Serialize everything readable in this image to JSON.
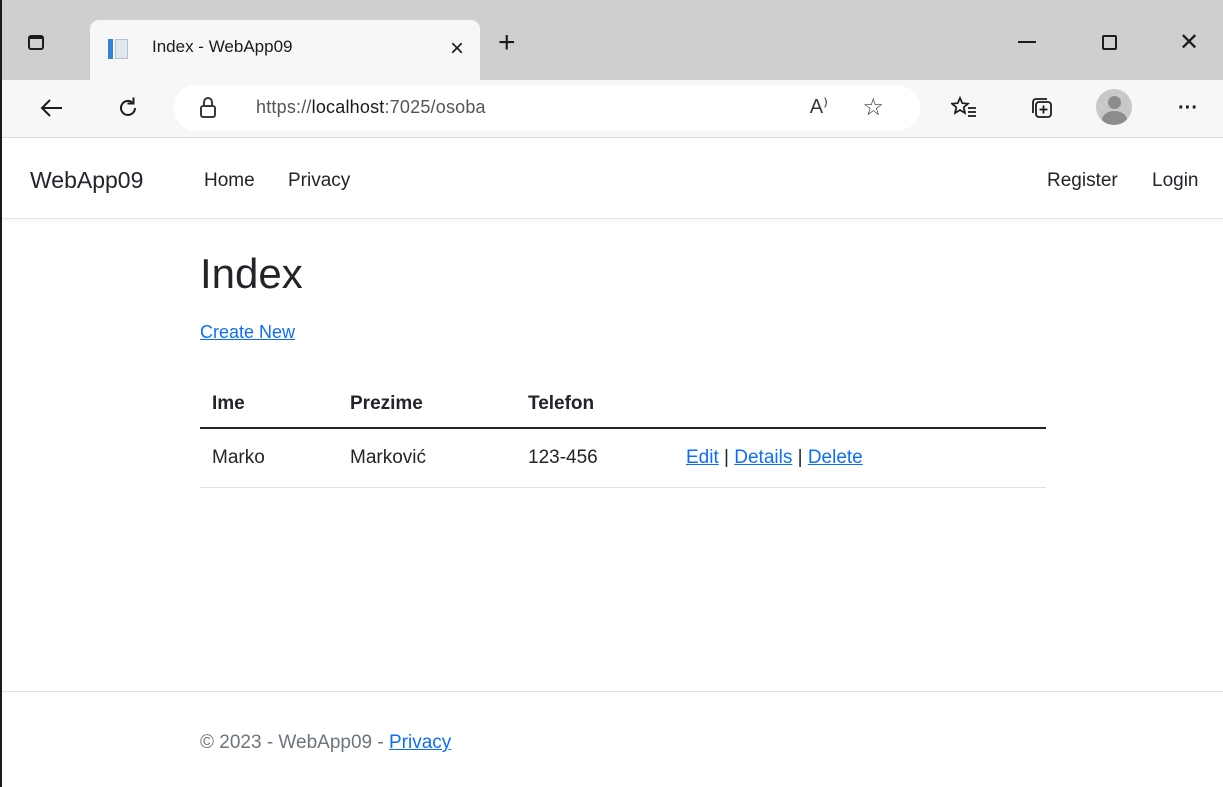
{
  "browser": {
    "tab_title": "Index - WebApp09",
    "tab_close": "×",
    "new_tab": "+",
    "url_prefix": "https://",
    "url_host": "localhost",
    "url_rest": ":7025/osoba",
    "read_aloud": "A⁾",
    "more": "···",
    "window_close": "✕"
  },
  "navbar": {
    "brand": "WebApp09",
    "links": [
      "Home",
      "Privacy"
    ],
    "right_links": [
      "Register",
      "Login"
    ]
  },
  "main": {
    "title": "Index",
    "create_link": "Create New",
    "table": {
      "headers": [
        "Ime",
        "Prezime",
        "Telefon",
        ""
      ],
      "rows": [
        {
          "ime": "Marko",
          "prezime": "Marković",
          "telefon": "123-456",
          "actions": [
            "Edit",
            "Details",
            "Delete"
          ],
          "separator": "|"
        }
      ]
    }
  },
  "footer": {
    "text": "© 2023 - WebApp09 - ",
    "link": "Privacy"
  },
  "colors": {
    "link": "#0d6efd",
    "tabstrip": "#cfcfcf",
    "toolbar": "#f7f7f7"
  }
}
